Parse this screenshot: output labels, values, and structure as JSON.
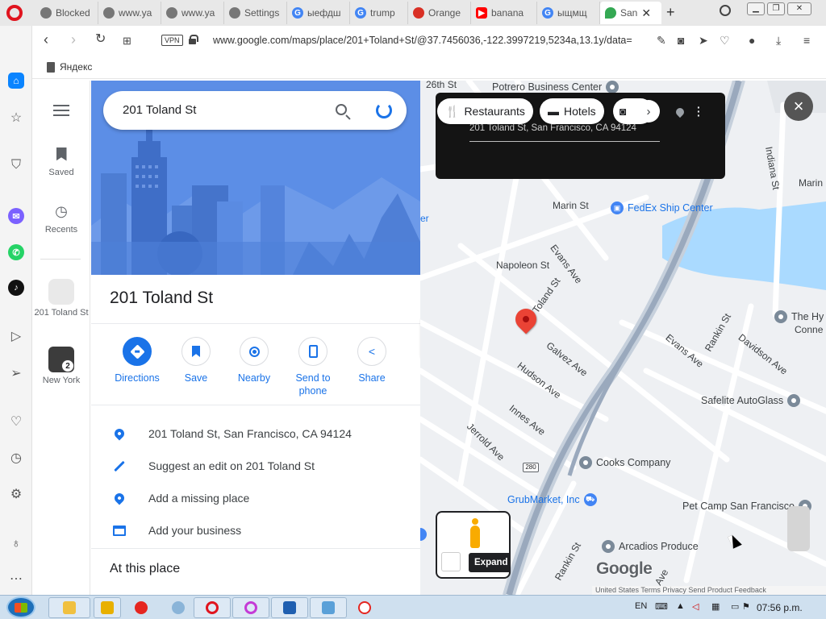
{
  "browser": {
    "tabs": [
      {
        "label": "Blocked",
        "icon": "globe-icon",
        "color": "#666666"
      },
      {
        "label": "www.ya",
        "icon": "globe-icon",
        "color": "#666666"
      },
      {
        "label": "www.ya",
        "icon": "globe-icon",
        "color": "#666666"
      },
      {
        "label": "Settings",
        "icon": "gear-icon",
        "color": "#666666"
      },
      {
        "label": "ыефдш",
        "icon": "google-icon",
        "color": "#4285f4"
      },
      {
        "label": "trump",
        "icon": "google-icon",
        "color": "#4285f4"
      },
      {
        "label": "Orange",
        "icon": "orange-icon",
        "color": "#d93025"
      },
      {
        "label": "banana",
        "icon": "youtube-icon",
        "color": "#ff0000"
      },
      {
        "label": "ыщмщ",
        "icon": "google-icon",
        "color": "#4285f4"
      },
      {
        "label": "San",
        "icon": "maps-pin-icon",
        "color": "#34a853",
        "active": true
      }
    ],
    "url": "www.google.com/maps/place/201+Toland+St/@37.7456036,-122.3997219,5234a,13.1y/data=",
    "vpn_label": "VPN",
    "bookmark": "Яндекс"
  },
  "rail": {
    "saved": "Saved",
    "recents": "Recents",
    "recent_place": "201 Toland St",
    "recent_city": "New York",
    "recent_city_badge": "2"
  },
  "place": {
    "search_value": "201 Toland St",
    "title": "201 Toland St",
    "actions": [
      {
        "label": "Directions"
      },
      {
        "label": "Save"
      },
      {
        "label": "Nearby"
      },
      {
        "label": "Send to phone"
      },
      {
        "label": "Share"
      }
    ],
    "info": [
      "201 Toland St, San Francisco, CA 94124",
      "Suggest an edit on 201 Toland St",
      "Add a missing place",
      "Add your business"
    ],
    "at_this_place": "At this place"
  },
  "map": {
    "chips": [
      "Restaurants",
      "Hotels"
    ],
    "overlay_address": "201 Toland St, San Francisco, CA 94124",
    "streets": [
      "26th St",
      "Indiana St",
      "Marin St",
      "Marin",
      "Napoleon St",
      "Evans Ave",
      "Toland St",
      "Galvez Ave",
      "Hudson Ave",
      "Innes Ave",
      "Jerrold Ave",
      "Evans Ave",
      "Rankin St",
      "Davidson Ave",
      "Rankin St",
      "Ave",
      "er"
    ],
    "pois": [
      "Potrero Business Center",
      "FedEx Ship Center",
      "The Hy",
      "Conne",
      "Safelite AutoGlass",
      "Cooks Company",
      "GrubMarket, Inc",
      "Pet Camp San Francisco",
      "Arcadios Produce"
    ],
    "highway": "280",
    "expand": "Expand",
    "logo": "Google",
    "attribution": "United States    Terms    Privacy    Send Product Feedback"
  },
  "taskbar": {
    "lang": "EN",
    "time": "07:56 p.m."
  }
}
